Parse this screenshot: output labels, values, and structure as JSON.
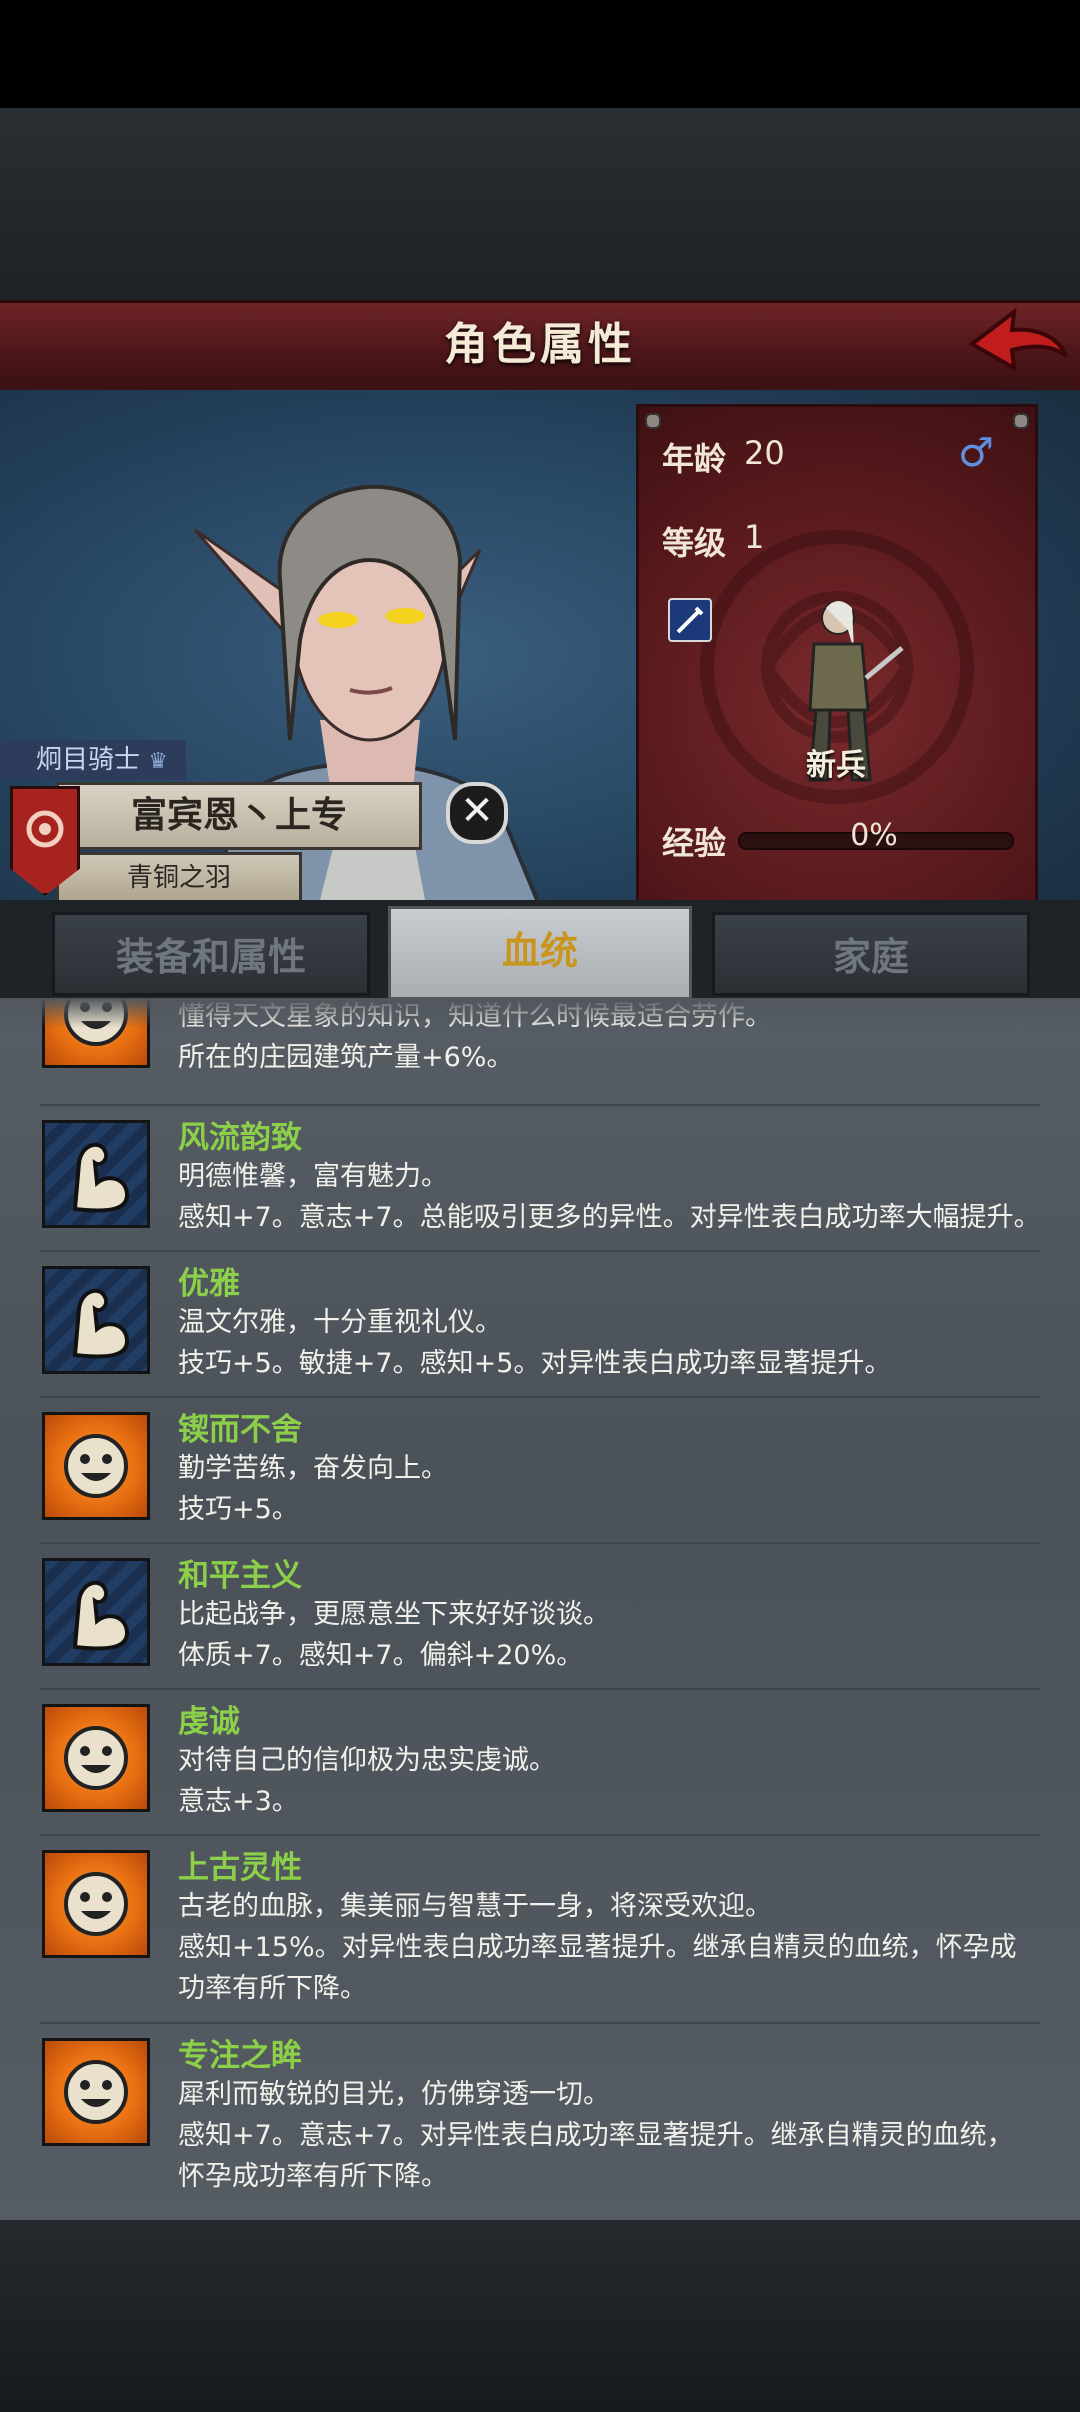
{
  "header": {
    "title": "角色属性"
  },
  "character": {
    "rank": "炯目骑士",
    "name": "富宾恩丶上专",
    "title": "青铜之羽",
    "age_label": "年龄",
    "age": "20",
    "gender_icon": "male-symbol-icon",
    "level_label": "等级",
    "level": "1",
    "unit_name": "新兵",
    "exp_label": "经验",
    "exp_percent": "0%",
    "exp_fraction": 0.0
  },
  "tabs": [
    {
      "label": "装备和属性",
      "active": false
    },
    {
      "label": "血统",
      "active": true
    },
    {
      "label": "家庭",
      "active": false
    }
  ],
  "traits": [
    {
      "icon": "sun-face-icon",
      "name": "",
      "lines": [
        "懂得天文星象的知识，知道什么时候最适合劳作。",
        "所在的庄园建筑产量+6%。"
      ]
    },
    {
      "icon": "flexed-arm-icon",
      "name": "风流韵致",
      "lines": [
        "明德惟馨，富有魅力。",
        "感知+7。意志+7。总能吸引更多的异性。对异性表白成功率大幅提升。"
      ]
    },
    {
      "icon": "flexed-arm-icon",
      "name": "优雅",
      "lines": [
        "温文尔雅，十分重视礼仪。",
        "技巧+5。敏捷+7。感知+5。对异性表白成功率显著提升。"
      ]
    },
    {
      "icon": "sun-face-icon",
      "name": "锲而不舍",
      "lines": [
        "勤学苦练，奋发向上。",
        "技巧+5。"
      ]
    },
    {
      "icon": "flexed-arm-icon",
      "name": "和平主义",
      "lines": [
        "比起战争，更愿意坐下来好好谈谈。",
        "体质+7。感知+7。偏斜+20%。"
      ]
    },
    {
      "icon": "sun-face-icon",
      "name": "虔诚",
      "lines": [
        "对待自己的信仰极为忠实虔诚。",
        "意志+3。"
      ]
    },
    {
      "icon": "sun-face-icon",
      "name": "上古灵性",
      "lines": [
        "古老的血脉，集美丽与智慧于一身，将深受欢迎。",
        "感知+15%。对异性表白成功率显著提升。继承自精灵的血统，怀孕成",
        "功率有所下降。"
      ]
    },
    {
      "icon": "sun-face-icon",
      "name": "专注之眸",
      "lines": [
        "犀利而敏锐的目光，仿佛穿透一切。",
        "感知+7。意志+7。对异性表白成功率显著提升。继承自精灵的血统，",
        "怀孕成功率有所下降。"
      ]
    }
  ]
}
